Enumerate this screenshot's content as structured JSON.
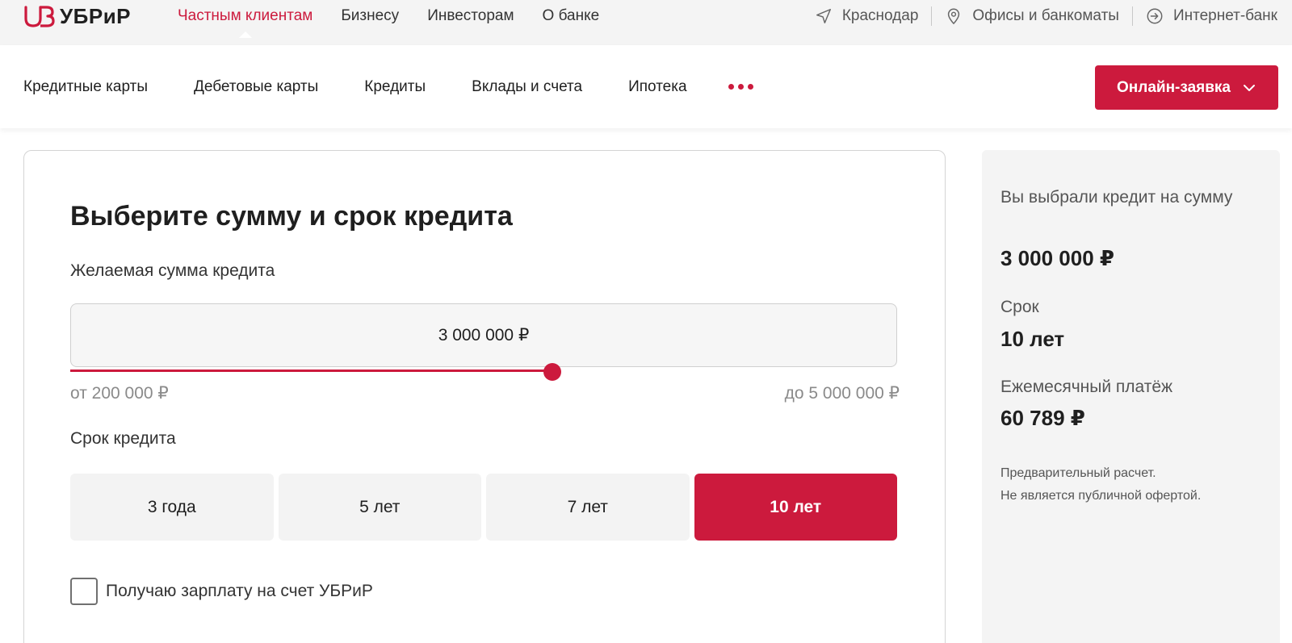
{
  "brand": {
    "name": "УБРиР",
    "accent": "#cc1a3d"
  },
  "topnav": {
    "items": [
      {
        "label": "Частным клиентам",
        "active": true
      },
      {
        "label": "Бизнесу"
      },
      {
        "label": "Инвесторам"
      },
      {
        "label": "О банке"
      }
    ]
  },
  "topright": {
    "city": "Краснодар",
    "offices": "Офисы и банкоматы",
    "internet_bank": "Интернет-банк"
  },
  "subnav": {
    "items": [
      {
        "label": "Кредитные карты"
      },
      {
        "label": "Дебетовые карты"
      },
      {
        "label": "Кредиты"
      },
      {
        "label": "Вклады и счета"
      },
      {
        "label": "Ипотека"
      }
    ],
    "apply_button": "Онлайн-заявка"
  },
  "calculator": {
    "title": "Выберите сумму и срок кредита",
    "amount_label": "Желаемая сумма кредита",
    "amount_value": "3 000 000 ₽",
    "range_min": "от 200 000 ₽",
    "range_max": "до 5 000 000 ₽",
    "slider": {
      "min": 200000,
      "max": 5000000,
      "value": 3000000
    },
    "term_label": "Срок кредита",
    "terms": [
      {
        "label": "3 года"
      },
      {
        "label": "5 лет"
      },
      {
        "label": "7 лет"
      },
      {
        "label": "10 лет",
        "selected": true
      }
    ],
    "salary_checkbox": {
      "label": "Получаю зарплату на счет УБРиР",
      "checked": false
    }
  },
  "summary": {
    "amount_label": "Вы выбрали кредит на сумму",
    "amount_value": "3 000 000 ₽",
    "term_label": "Срок",
    "term_value": "10 лет",
    "payment_label": "Ежемесячный платёж",
    "payment_value": "60 789 ₽",
    "note_line1": "Предварительный расчет.",
    "note_line2": "Не является публичной офертой."
  }
}
